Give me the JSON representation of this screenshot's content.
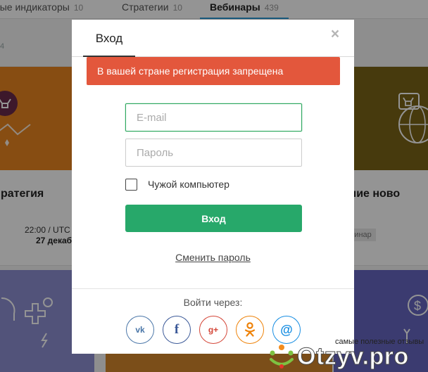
{
  "background": {
    "tabs": [
      {
        "label": "ные индикаторы",
        "count": "10",
        "active": false
      },
      {
        "label": "Стратегии",
        "count": "10",
        "active": false
      },
      {
        "label": "Вебинары",
        "count": "439",
        "active": true
      }
    ],
    "sub_number": "4",
    "cards": {
      "left_title": "ратегия",
      "left_time": "22:00 / UTC",
      "left_date": "27 декаб",
      "right_title": "рячие ново",
      "right_badge": "бинар"
    }
  },
  "modal": {
    "title": "Вход",
    "close_symbol": "×",
    "error_message": "В вашей стране регистрация запрещена",
    "email_placeholder": "E-mail",
    "password_placeholder": "Пароль",
    "foreign_computer_label": "Чужой компьютер",
    "login_button": "Вход",
    "change_password_link": "Сменить пароль",
    "login_via": "Войти через:",
    "social": [
      {
        "name": "vk-icon",
        "glyph": "vk"
      },
      {
        "name": "facebook-icon",
        "glyph": "f"
      },
      {
        "name": "google-plus-icon",
        "glyph": "g+"
      },
      {
        "name": "odnoklassniki-icon",
        "glyph": "ok"
      },
      {
        "name": "mail-ru-icon",
        "glyph": "@"
      }
    ]
  },
  "watermark": {
    "tagline": "самые полезные отзывы",
    "logo": "Otzyv.pro"
  },
  "colors": {
    "accent_green": "#27a86a",
    "error_red": "#e3573c",
    "focus_green": "#2fa860"
  }
}
